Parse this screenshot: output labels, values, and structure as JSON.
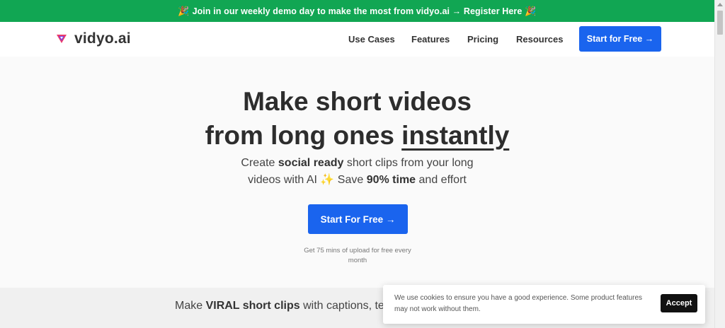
{
  "announcement": {
    "emoji_left": "🎉",
    "text": "Join in our weekly demo day to make the most from vidyo.ai → Register Here",
    "emoji_right": "🎉"
  },
  "nav": {
    "logo_text": "vidyo.ai",
    "links": [
      "Use Cases",
      "Features",
      "Pricing",
      "Resources"
    ],
    "cta": "Start for Free →"
  },
  "hero": {
    "headline_line1": "Make short videos",
    "headline_line2_start": "from long ones ",
    "headline_line2_underlined": "instantly",
    "sub_1": "Create ",
    "sub_2_bold": "social ready",
    "sub_3": " short clips from your long",
    "sub_4": "videos with AI ",
    "sub_sparkle": "✨",
    "sub_5": " Save ",
    "sub_6_bold": "90% time",
    "sub_7": " and effort",
    "cta": "Start For Free →",
    "note": "Get 75 mins of upload for free every month"
  },
  "band": {
    "text_1": "Make ",
    "text_bold": "VIRAL short clips",
    "text_2": " with captions, te"
  },
  "cookie": {
    "text": "We use cookies to ensure you have a good experience. Some product features may not work without them.",
    "accept": "Accept"
  },
  "colors": {
    "announcement_bg": "#11a653",
    "primary_blue": "#1a64ee",
    "accept_bg": "#111111"
  }
}
